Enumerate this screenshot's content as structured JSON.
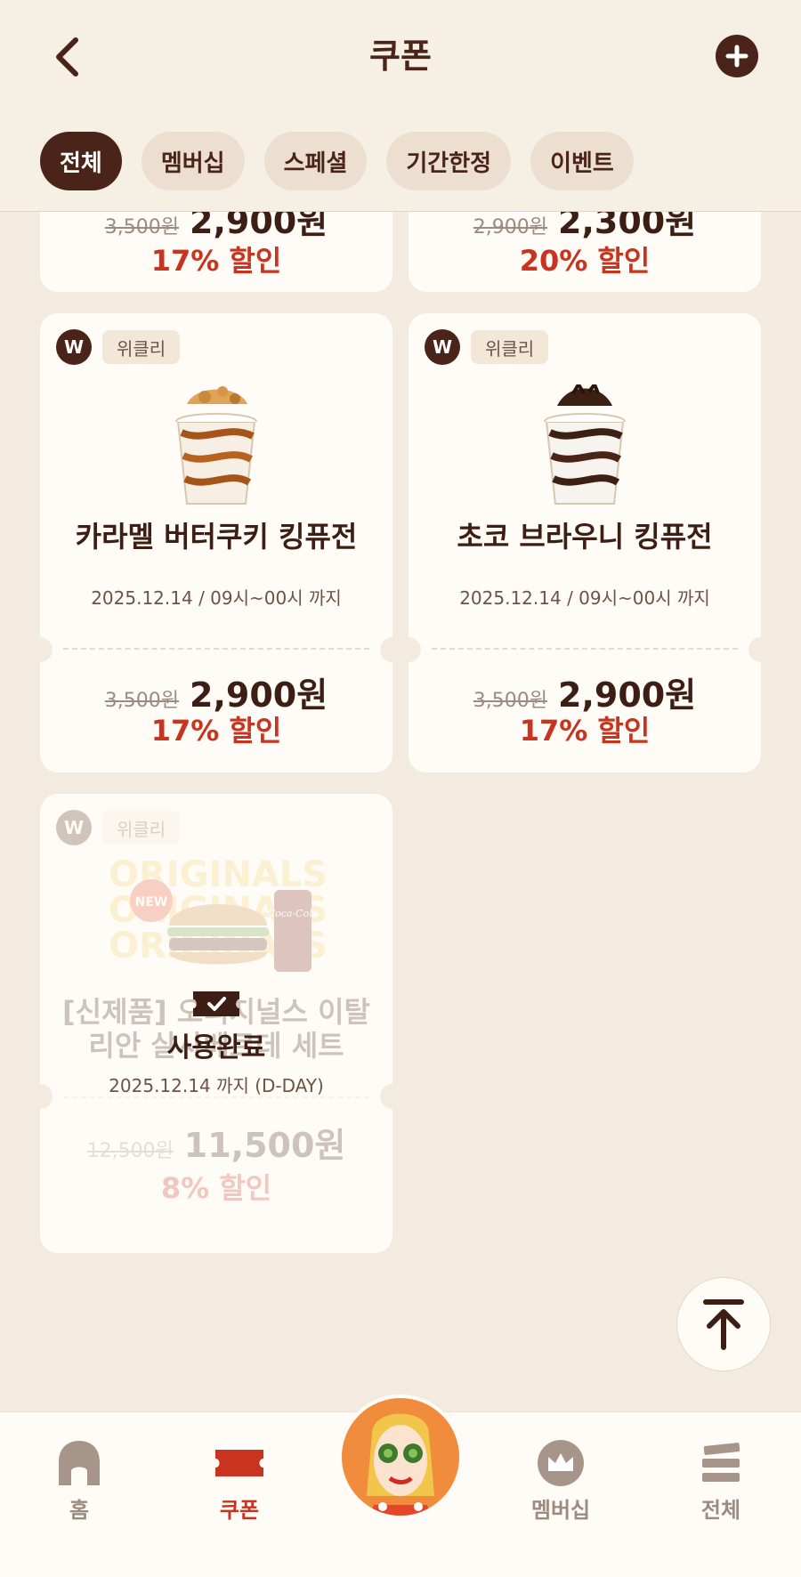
{
  "header": {
    "title": "쿠폰"
  },
  "tabs": [
    {
      "label": "전체",
      "active": true
    },
    {
      "label": "멤버십",
      "active": false
    },
    {
      "label": "스페셜",
      "active": false
    },
    {
      "label": "기간한정",
      "active": false
    },
    {
      "label": "이벤트",
      "active": false
    }
  ],
  "top_cards": [
    {
      "old_price": "3,500원",
      "new_price": "2,900원",
      "discount": "17% 할인"
    },
    {
      "old_price": "2,900원",
      "new_price": "2,300원",
      "discount": "20% 할인"
    }
  ],
  "cards": [
    {
      "badge": "W",
      "tag": "위클리",
      "name": "카라멜 버터쿠키 킹퓨전",
      "date": "2025.12.14 / 09시~00시 까지",
      "old_price": "3,500원",
      "new_price": "2,900원",
      "discount": "17% 할인"
    },
    {
      "badge": "W",
      "tag": "위클리",
      "name": "초코 브라우니 킹퓨전",
      "date": "2025.12.14 / 09시~00시 까지",
      "old_price": "3,500원",
      "new_price": "2,900원",
      "discount": "17% 할인"
    },
    {
      "badge": "W",
      "tag": "위클리",
      "name_line1": "[신제품] 오리지널스 이탈",
      "name_line2": "리안 살사베르데 세트",
      "date": "2025.12.14 까지  (D-DAY)",
      "old_price": "12,500원",
      "new_price": "11,500원",
      "discount": "8% 할인",
      "status": "사용완료",
      "image_text": "ORIGINALS",
      "image_badge": "NEW",
      "image_brand": "Coca-Cola"
    }
  ],
  "bottom_nav": [
    {
      "label": "홈",
      "active": false
    },
    {
      "label": "쿠폰",
      "active": true
    },
    {
      "label": "멤버십",
      "active": false
    },
    {
      "label": "전체",
      "active": false
    }
  ],
  "colors": {
    "brand": "#4a2418",
    "accent": "#c8341f",
    "background": "#f3ebdf"
  }
}
